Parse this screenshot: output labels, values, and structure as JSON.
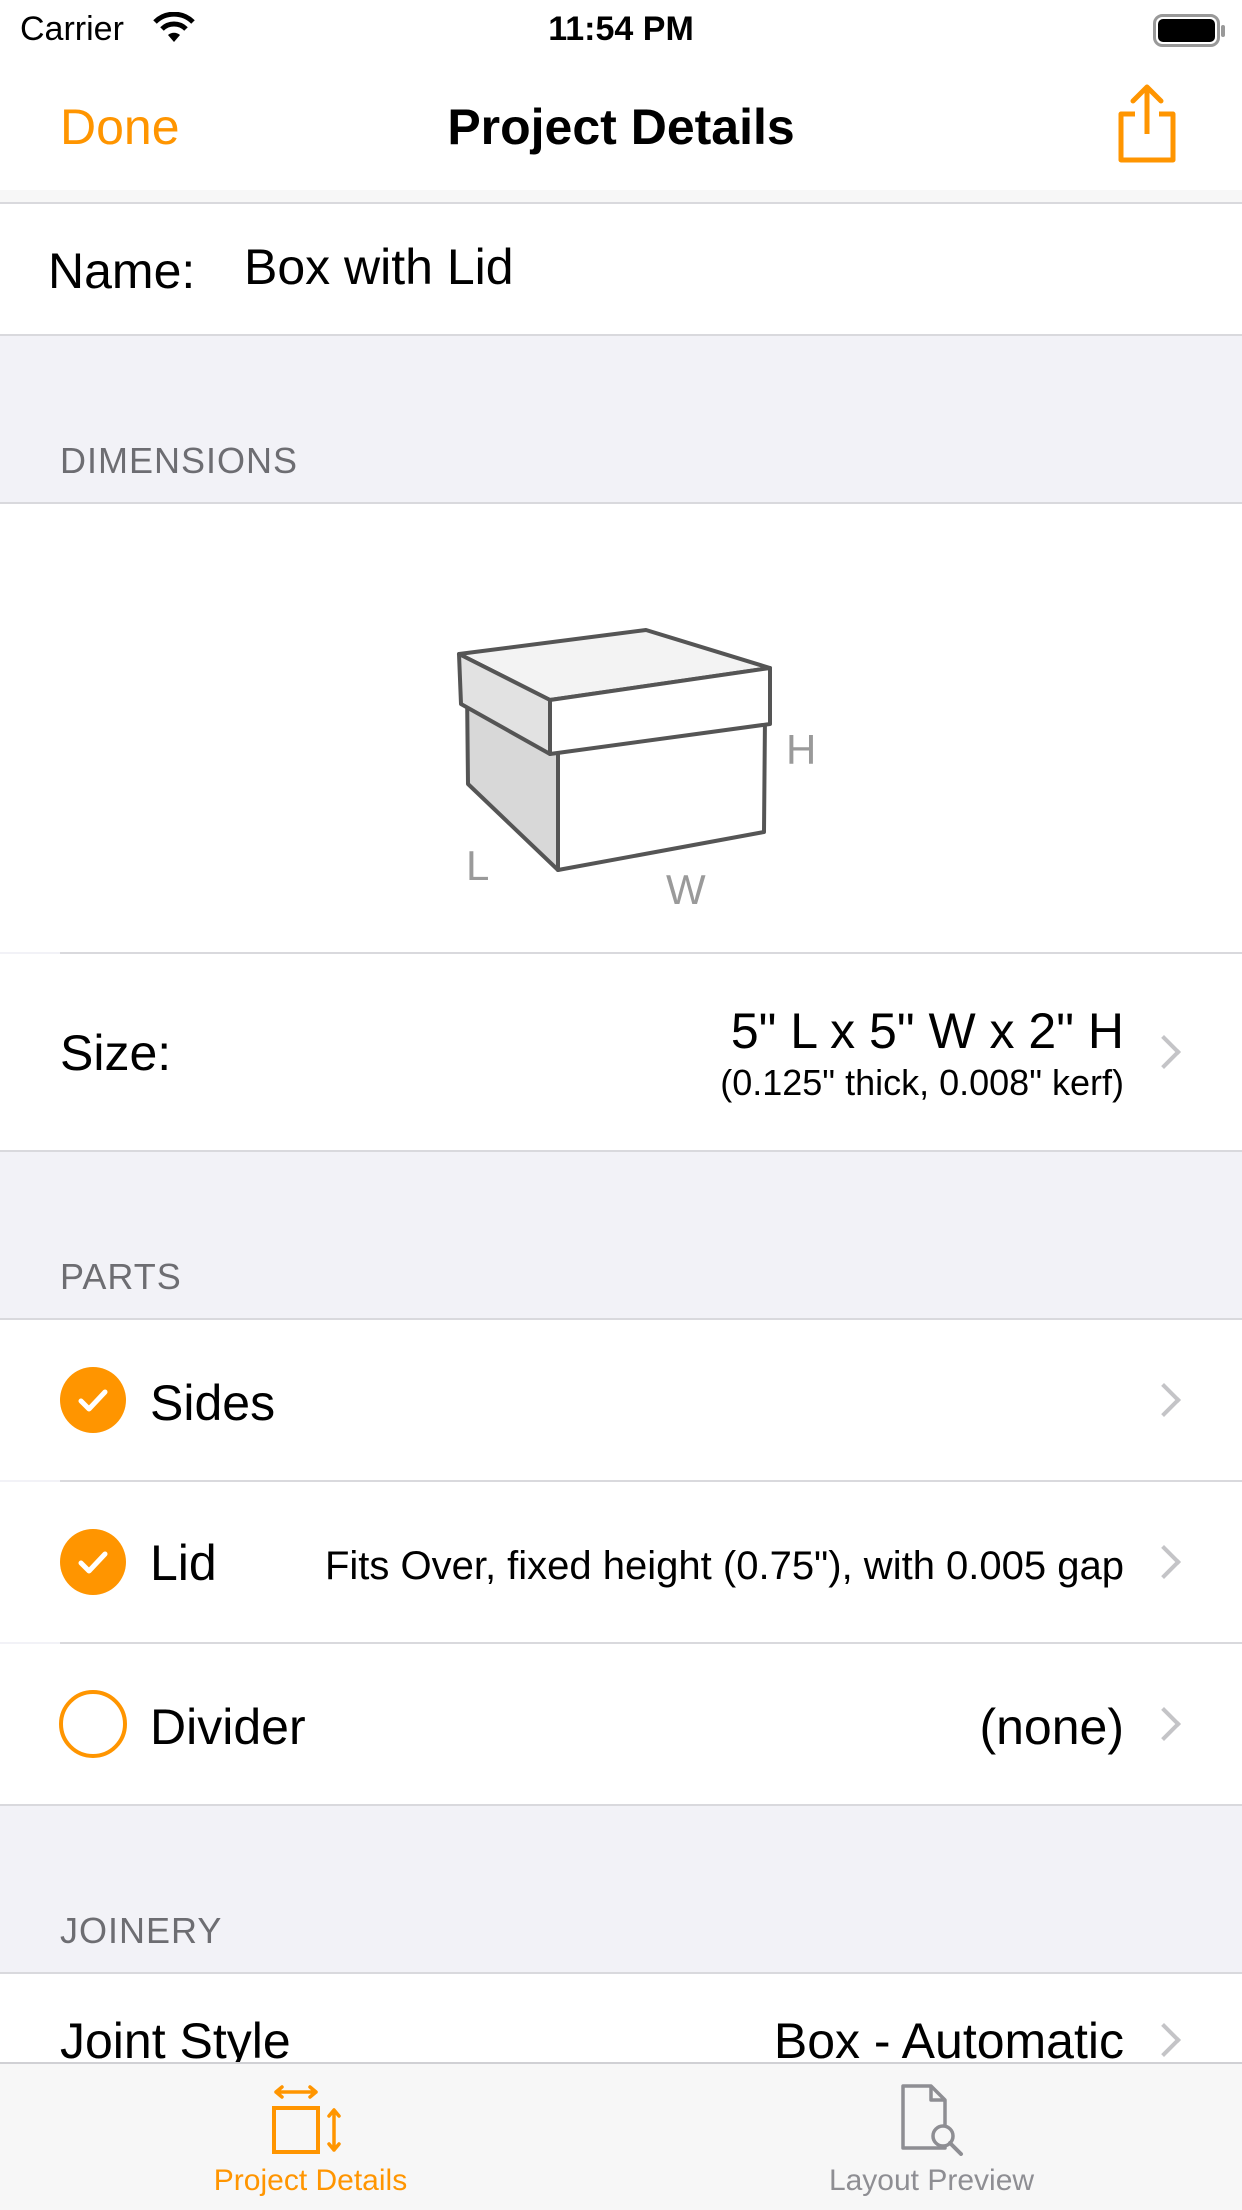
{
  "status_bar": {
    "carrier": "Carrier",
    "time": "11:54 PM"
  },
  "nav": {
    "done_label": "Done",
    "title": "Project Details",
    "share_icon": "share-icon"
  },
  "name_row": {
    "label": "Name:",
    "value": "Box with Lid"
  },
  "dimensions": {
    "header": "DIMENSIONS",
    "diagram_labels": {
      "h": "H",
      "l": "L",
      "w": "W"
    },
    "size_label": "Size:",
    "size_value": "5\" L x 5\" W x 2\" H",
    "size_detail": "(0.125\" thick, 0.008\" kerf)"
  },
  "parts": {
    "header": "PARTS",
    "items": [
      {
        "label": "Sides",
        "detail": "",
        "checked": true
      },
      {
        "label": "Lid",
        "detail": "Fits Over, fixed height (0.75\"), with 0.005 gap",
        "checked": true
      },
      {
        "label": "Divider",
        "detail": "(none)",
        "checked": false
      }
    ]
  },
  "joinery": {
    "header": "JOINERY",
    "joint_style_label": "Joint Style",
    "joint_style_value": "Box - Automatic"
  },
  "tabs": [
    {
      "label": "Project Details",
      "icon": "dimensions-icon",
      "active": true
    },
    {
      "label": "Layout Preview",
      "icon": "document-search-icon",
      "active": false
    }
  ],
  "colors": {
    "accent": "#ff9500",
    "group_background": "#f2f2f7",
    "secondary_text": "#6d6d72",
    "inactive_tab": "#8e8e93"
  }
}
